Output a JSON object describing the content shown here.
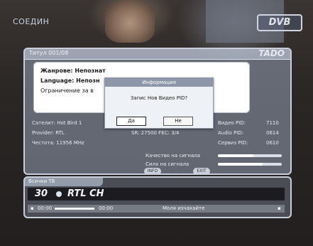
{
  "screen": {
    "top_left_label": "СОЕДИН",
    "logo_text": "DVB"
  },
  "info_panel": {
    "title": "Титул 001/08",
    "logo": "TADO",
    "genre": "Жанрове: Непознат",
    "language": "Language: Непозн",
    "restriction": "Ограничение за в",
    "tech": {
      "satellite": "Сателит: Hot Bird 1",
      "provider": "Provider: RTL",
      "frequency": "Честота: 11956 MHz",
      "sr_fec": "SR: 27500  FEC: 3/4",
      "video_pid": "Видео PID:",
      "video_pid_val": "7110",
      "audio_pid": "Audio PID:",
      "audio_pid_val": "0614",
      "service_pid": "Сервиз PID:",
      "service_pid_val": "0610"
    },
    "signal_quality_label": "Качество на сигнала",
    "signal_quality": 0.55,
    "signal_strength_label": "Сила на сигнала",
    "signal_strength": 0.7,
    "buttons": [
      "INFO",
      "EXIT"
    ]
  },
  "dialog": {
    "title": "Информация",
    "message": "Запис Нов Видео PID?",
    "yes_label": "Да",
    "no_label": "Не",
    "selected": "yes"
  },
  "channel_bar": {
    "head_label": "Всички ТВ",
    "number": "30",
    "name": "RTL CH",
    "time_start": "00:00",
    "time_end": "00:00",
    "program": "Моля изчакайте",
    "progress": 0.4
  }
}
